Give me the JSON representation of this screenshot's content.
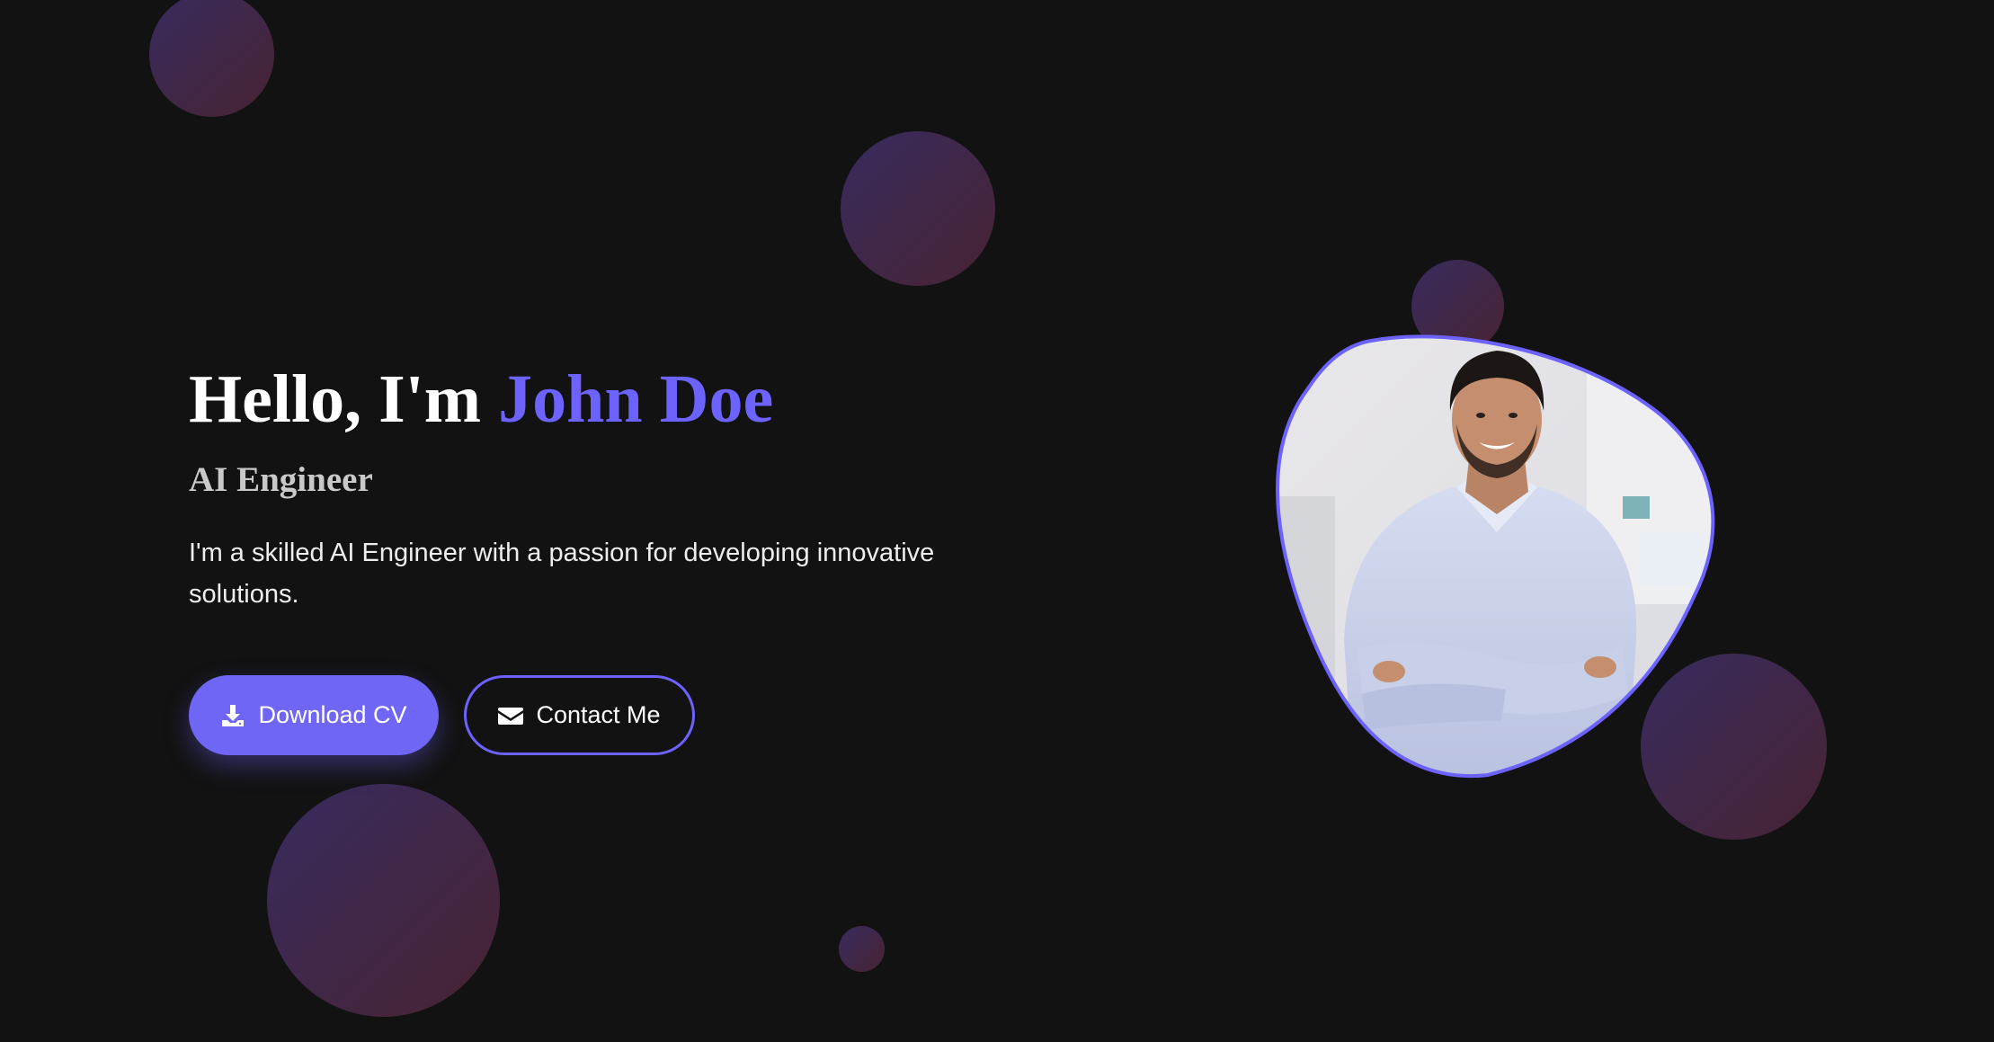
{
  "hero": {
    "greeting": "Hello, I'm ",
    "name": "John Doe",
    "role": "AI Engineer",
    "description": "I'm a skilled AI Engineer with a passion for developing innovative solutions."
  },
  "buttons": {
    "download_label": "Download CV",
    "download_icon": "download-icon",
    "contact_label": "Contact Me",
    "contact_icon": "envelope-icon"
  },
  "portrait": {
    "alt": "Portrait of a smiling man with arms crossed"
  },
  "colors": {
    "background": "#121212",
    "accent": "#6c63ff",
    "bubble_start": "#3a2d63",
    "bubble_end": "#4a2433"
  }
}
